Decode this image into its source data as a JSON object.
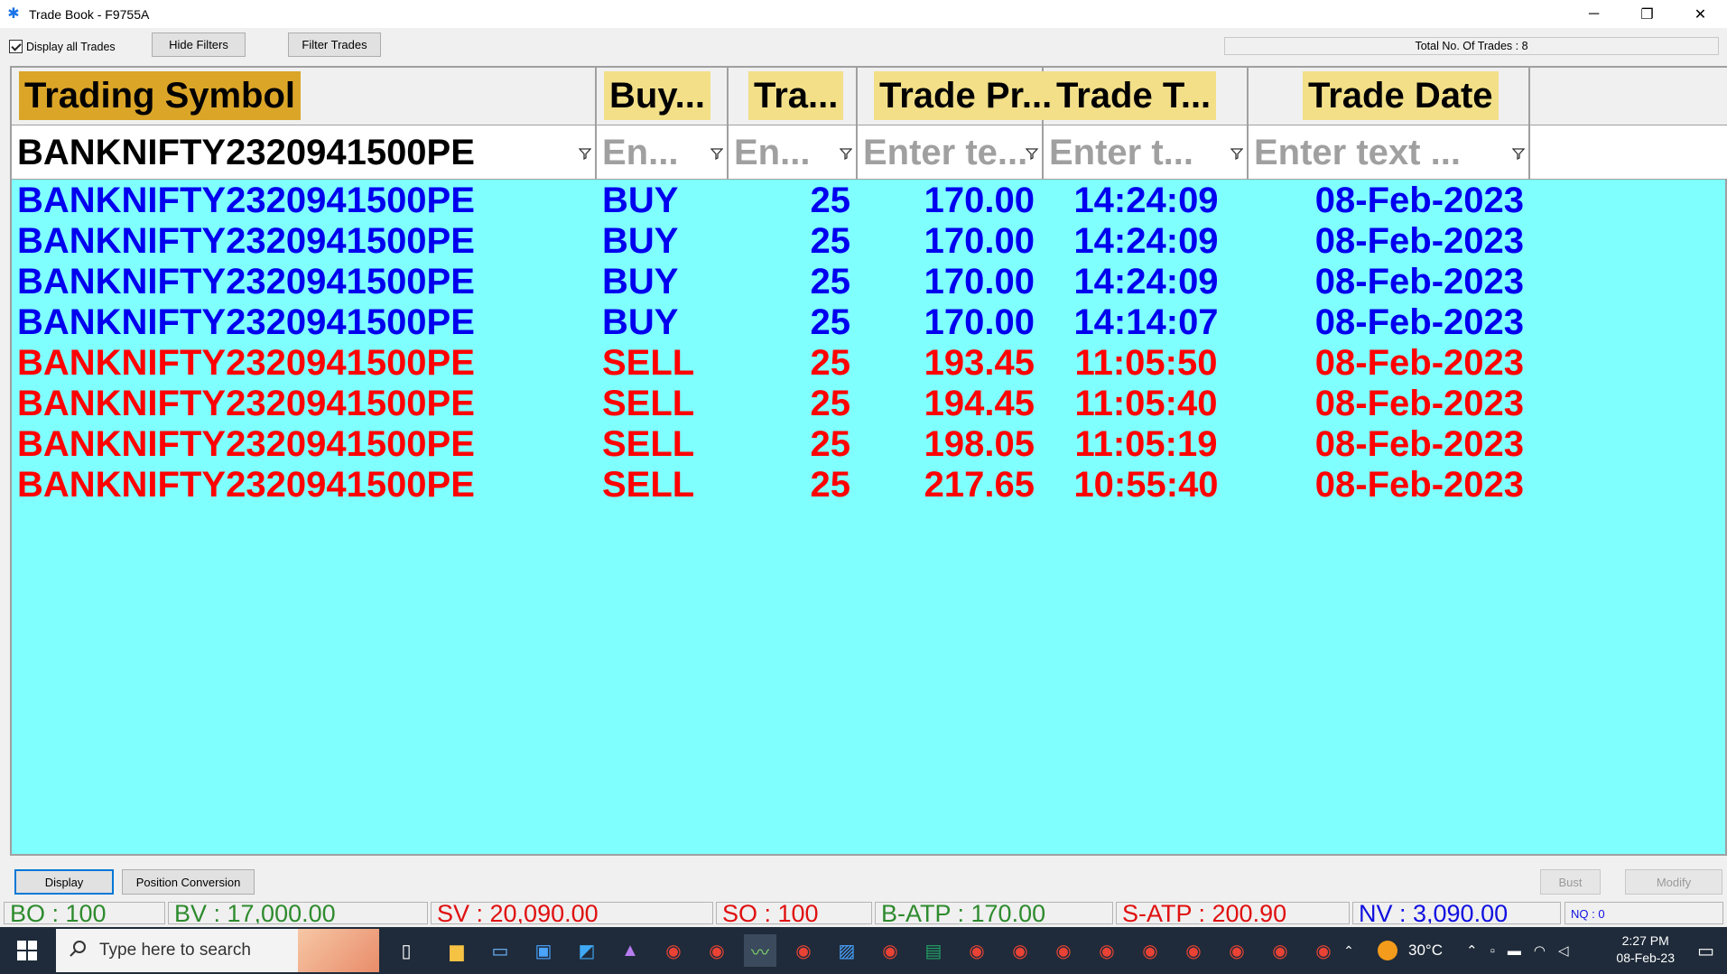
{
  "window": {
    "title": "Trade Book - F9755A",
    "minimize": "─",
    "maximize": "❐",
    "close": "✕"
  },
  "toolbar": {
    "display_all_label": "Display all Trades",
    "hide_filters_label": "Hide Filters",
    "filter_trades_label": "Filter Trades",
    "total_trades": "Total No. Of Trades : 8"
  },
  "grid": {
    "columns": [
      "Trading Symbol",
      "Buy...",
      "Tra...",
      "Trade Pr...",
      "Trade T...",
      "Trade Date"
    ],
    "filters": {
      "symbol": "BANKNIFTY2320941500PE",
      "buy_placeholder": "En...",
      "qty_placeholder": "En...",
      "price_placeholder": "Enter te...",
      "time_placeholder": "Enter t...",
      "date_placeholder": "Enter text ..."
    },
    "rows": [
      {
        "symbol": "BANKNIFTY2320941500PE",
        "side": "BUY",
        "qty": "25",
        "price": "170.00",
        "time": "14:24:09",
        "date": "08-Feb-2023"
      },
      {
        "symbol": "BANKNIFTY2320941500PE",
        "side": "BUY",
        "qty": "25",
        "price": "170.00",
        "time": "14:24:09",
        "date": "08-Feb-2023"
      },
      {
        "symbol": "BANKNIFTY2320941500PE",
        "side": "BUY",
        "qty": "25",
        "price": "170.00",
        "time": "14:24:09",
        "date": "08-Feb-2023"
      },
      {
        "symbol": "BANKNIFTY2320941500PE",
        "side": "BUY",
        "qty": "25",
        "price": "170.00",
        "time": "14:14:07",
        "date": "08-Feb-2023"
      },
      {
        "symbol": "BANKNIFTY2320941500PE",
        "side": "SELL",
        "qty": "25",
        "price": "193.45",
        "time": "11:05:50",
        "date": "08-Feb-2023"
      },
      {
        "symbol": "BANKNIFTY2320941500PE",
        "side": "SELL",
        "qty": "25",
        "price": "194.45",
        "time": "11:05:40",
        "date": "08-Feb-2023"
      },
      {
        "symbol": "BANKNIFTY2320941500PE",
        "side": "SELL",
        "qty": "25",
        "price": "198.05",
        "time": "11:05:19",
        "date": "08-Feb-2023"
      },
      {
        "symbol": "BANKNIFTY2320941500PE",
        "side": "SELL",
        "qty": "25",
        "price": "217.65",
        "time": "10:55:40",
        "date": "08-Feb-2023"
      }
    ]
  },
  "bottom": {
    "display": "Display",
    "position_conversion": "Position Conversion",
    "bust": "Bust",
    "modify": "Modify"
  },
  "status": {
    "bo": "BO : 100",
    "bv": "BV : 17,000.00",
    "sv": "SV : 20,090.00",
    "so": "SO : 100",
    "batp": "B-ATP : 170.00",
    "satp": "S-ATP : 200.90",
    "nv": "NV : 3,090.00",
    "nq": "NQ : 0"
  },
  "taskbar": {
    "search_placeholder": "Type here to search",
    "temperature": "30°C",
    "time": "2:27 PM",
    "date": "08-Feb-23"
  },
  "colors": {
    "grid_bg": "#80ffff",
    "buy": "#0000ee",
    "sell": "#ff0000",
    "header_first": "#dba528",
    "header": "#f2df88"
  }
}
